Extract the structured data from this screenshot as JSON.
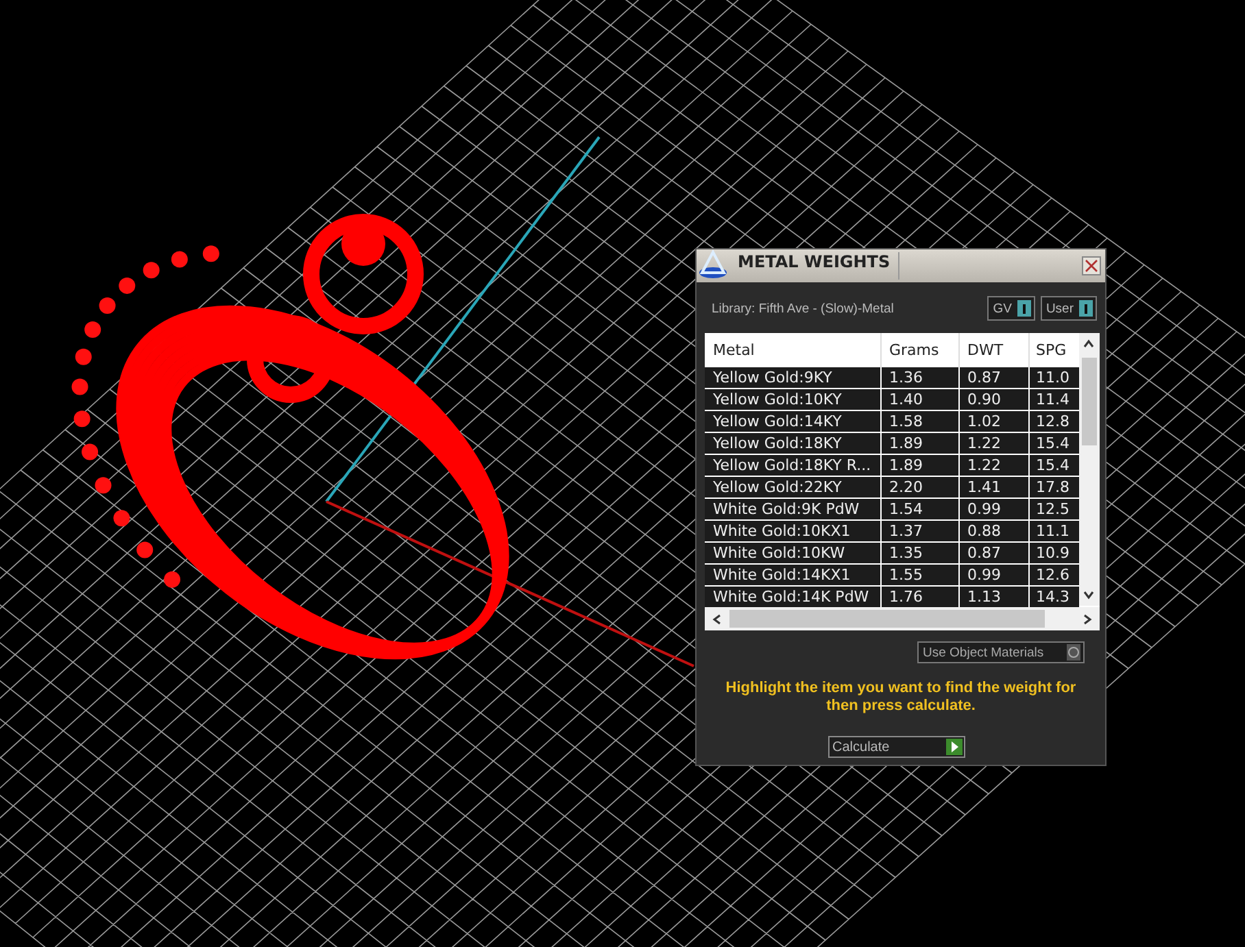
{
  "panel": {
    "title": "METAL WEIGHTS",
    "library": "Library: Fifth Ave - (Slow)-Metal",
    "toggles": [
      {
        "label": "GV",
        "on": true
      },
      {
        "label": "User",
        "on": true
      }
    ],
    "table": {
      "columns": [
        "Metal",
        "Grams",
        "DWT",
        "SPG"
      ],
      "rows": [
        [
          "Yellow Gold:9KY",
          "1.36",
          "0.87",
          "11.0"
        ],
        [
          "Yellow Gold:10KY",
          "1.40",
          "0.90",
          "11.4"
        ],
        [
          "Yellow Gold:14KY",
          "1.58",
          "1.02",
          "12.8"
        ],
        [
          "Yellow Gold:18KY",
          "1.89",
          "1.22",
          "15.4"
        ],
        [
          "Yellow Gold:18KY R...",
          "1.89",
          "1.22",
          "15.4"
        ],
        [
          "Yellow Gold:22KY",
          "2.20",
          "1.41",
          "17.8"
        ],
        [
          "White Gold:9K PdW",
          "1.54",
          "0.99",
          "12.5"
        ],
        [
          "White Gold:10KX1",
          "1.37",
          "0.88",
          "11.1"
        ],
        [
          "White Gold:10KW",
          "1.35",
          "0.87",
          "10.9"
        ],
        [
          "White Gold:14KX1",
          "1.55",
          "0.99",
          "12.6"
        ],
        [
          "White Gold:14K PdW",
          "1.76",
          "1.13",
          "14.3"
        ]
      ]
    },
    "use_object_materials": {
      "label": "Use Object Materials",
      "on": false
    },
    "hint": "Highlight the item you want to find the weight for then press calculate.",
    "button": "Calculate"
  }
}
